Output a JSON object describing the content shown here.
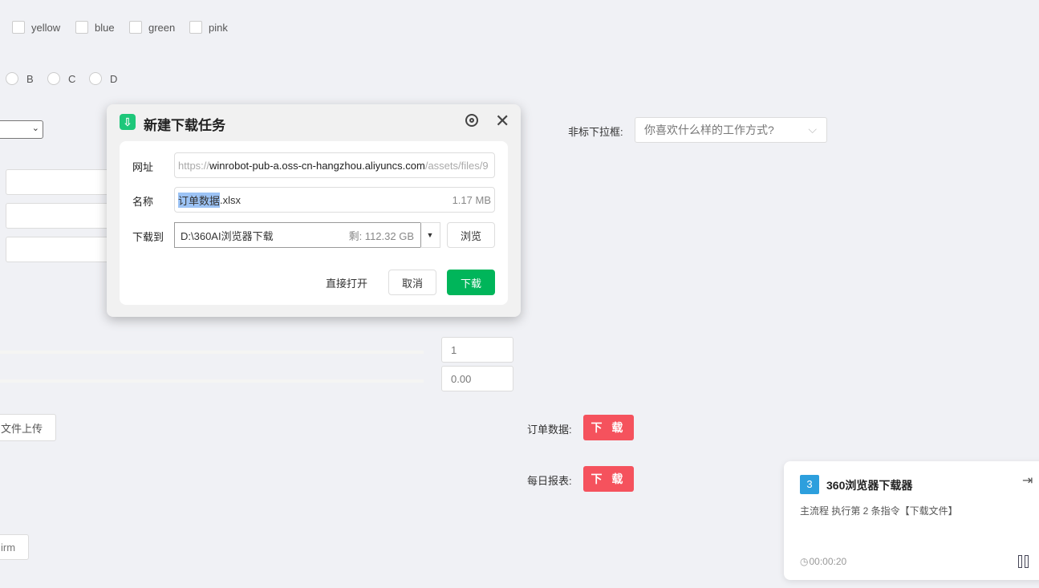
{
  "checkboxes": [
    "yellow",
    "blue",
    "green",
    "pink"
  ],
  "radios": [
    "B",
    "C",
    "D"
  ],
  "inputs": {
    "number": "1",
    "decimal": "0.00"
  },
  "buttons": {
    "upload": "文件上传",
    "confirm": "irm"
  },
  "dropdown": {
    "label": "非标下拉框:",
    "placeholder": "你喜欢什么样的工作方式?"
  },
  "downloads": [
    {
      "label": "订单数据:",
      "button": "下 载"
    },
    {
      "label": "每日报表:",
      "button": "下 载"
    }
  ],
  "dialog": {
    "title": "新建下载任务",
    "url_label": "网址",
    "url_prefix": "https://",
    "url_host": "winrobot-pub-a.oss-cn-hangzhou.aliyuncs.com",
    "url_path": "/assets/files/9",
    "name_label": "名称",
    "name_selected": "订单数据",
    "name_ext": ".xlsx",
    "size": "1.17 MB",
    "dest_label": "下载到",
    "dest_path": "D:\\360AI浏览器下载",
    "free_space": "剩: 112.32 GB",
    "browse": "浏览",
    "open_direct": "直接打开",
    "cancel": "取消",
    "download": "下载",
    "accent": "#00b55a"
  },
  "card": {
    "step": "3",
    "title": "360浏览器下载器",
    "status": "主流程 执行第 2 条指令【下载文件】",
    "timer": "00:00:20"
  }
}
